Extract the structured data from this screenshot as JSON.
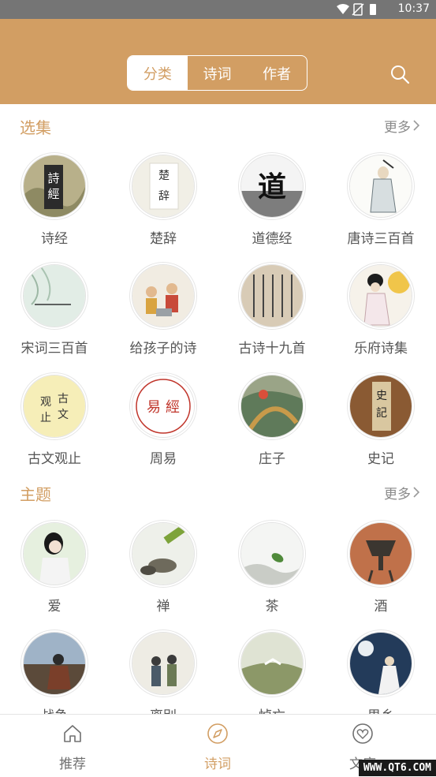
{
  "status_bar": {
    "time": "10:37"
  },
  "header": {
    "tabs": [
      {
        "label": "分类",
        "active": true
      },
      {
        "label": "诗词",
        "active": false
      },
      {
        "label": "作者",
        "active": false
      }
    ],
    "accent_color": "#d29e63"
  },
  "collections": {
    "title": "选集",
    "more": "更多",
    "items": [
      {
        "label": "诗经"
      },
      {
        "label": "楚辞"
      },
      {
        "label": "道德经"
      },
      {
        "label": "唐诗三百首"
      },
      {
        "label": "宋词三百首"
      },
      {
        "label": "给孩子的诗"
      },
      {
        "label": "古诗十九首"
      },
      {
        "label": "乐府诗集"
      },
      {
        "label": "古文观止"
      },
      {
        "label": "周易"
      },
      {
        "label": "庄子"
      },
      {
        "label": "史记"
      }
    ]
  },
  "themes": {
    "title": "主题",
    "more": "更多",
    "items": [
      {
        "label": "爱"
      },
      {
        "label": "禅"
      },
      {
        "label": "茶"
      },
      {
        "label": "酒"
      },
      {
        "label": "战争"
      },
      {
        "label": "离别"
      },
      {
        "label": "悼亡"
      },
      {
        "label": "思乡"
      }
    ]
  },
  "bottom_nav": [
    {
      "label": "推荐",
      "icon": "home-icon",
      "active": false
    },
    {
      "label": "诗词",
      "icon": "compass-icon",
      "active": true
    },
    {
      "label": "文库",
      "icon": "heart-icon",
      "active": false
    }
  ],
  "watermark": "WWW.QT6.COM"
}
